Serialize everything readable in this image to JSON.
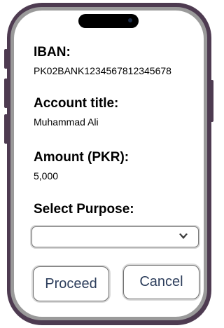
{
  "form": {
    "iban_label": "IBAN:",
    "iban_value": "PK02BANK1234567812345678",
    "account_title_label": "Account title:",
    "account_title_value": "Muhammad Ali",
    "amount_label": "Amount (PKR):",
    "amount_value": "5,000",
    "purpose_label": "Select Purpose:",
    "purpose_selected": ""
  },
  "actions": {
    "proceed_label": "Proceed",
    "cancel_label": "Cancel"
  },
  "icons": {
    "dropdown": "chevron-down-icon"
  },
  "colors": {
    "phone_frame": "#4e3b51",
    "button_text": "#2d3e5c"
  }
}
